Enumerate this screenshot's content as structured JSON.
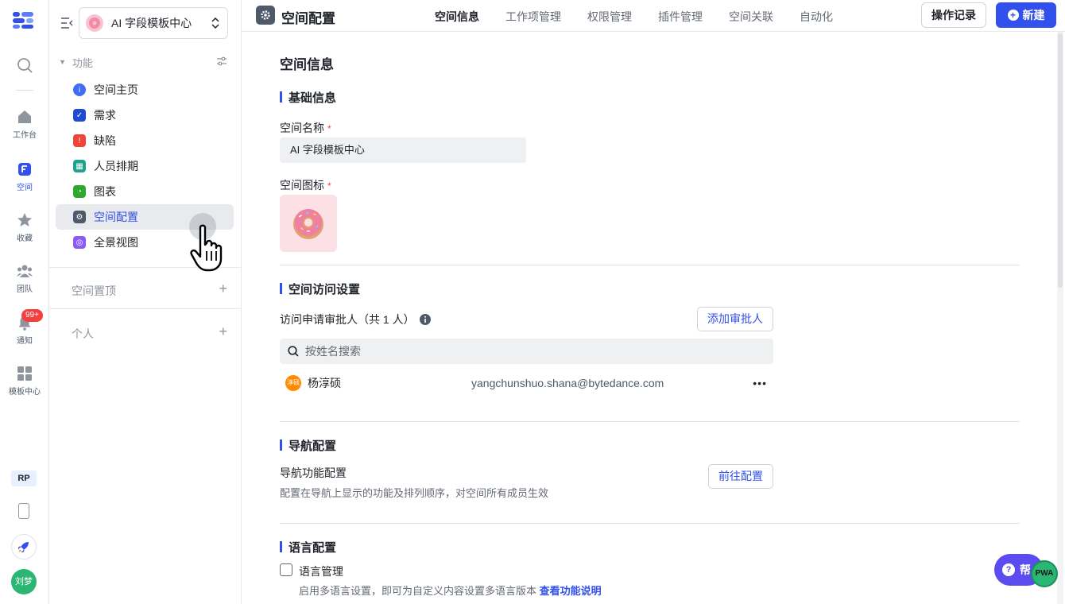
{
  "rail": {
    "items": [
      {
        "label": "工作台",
        "icon": "home-icon"
      },
      {
        "label": "空间",
        "icon": "space-icon",
        "active": true
      },
      {
        "label": "收藏",
        "icon": "star-icon"
      },
      {
        "label": "团队",
        "icon": "team-icon"
      },
      {
        "label": "通知",
        "icon": "bell-icon"
      },
      {
        "label": "模板中心",
        "icon": "template-grid-icon"
      }
    ],
    "notification_badge": "99+",
    "workspace_tag": "RP",
    "user_avatar_text": "刘梦"
  },
  "sidebar": {
    "space_name": "AI 字段模板中心",
    "group_title": "功能",
    "items": [
      {
        "label": "空间主页",
        "color": "#3f6df6",
        "glyph": "i"
      },
      {
        "label": "需求",
        "color": "#1f4bd1",
        "glyph": "✓"
      },
      {
        "label": "缺陷",
        "color": "#f04437",
        "glyph": "!"
      },
      {
        "label": "人员排期",
        "color": "#1fa28c",
        "glyph": "▦"
      },
      {
        "label": "图表",
        "color": "#2fa82f",
        "glyph": "◔"
      },
      {
        "label": "空间配置",
        "color": "#4e5969",
        "glyph": "⚙",
        "active": true
      },
      {
        "label": "全景视图",
        "color": "#8a5cf5",
        "glyph": "◎"
      }
    ],
    "section_pinned": "空间置顶",
    "section_personal": "个人"
  },
  "header": {
    "title": "空间配置",
    "tabs": [
      "空间信息",
      "工作项管理",
      "权限管理",
      "插件管理",
      "空间关联",
      "自动化"
    ],
    "active_tab": "空间信息",
    "log_button": "操作记录",
    "new_button": "新建"
  },
  "main": {
    "page_title": "空间信息",
    "basic": {
      "heading": "基础信息",
      "name_label": "空间名称",
      "name_value": "AI 字段模板中心",
      "icon_label": "空间图标",
      "required_mark": "*"
    },
    "access": {
      "heading": "空间访问设置",
      "approver_label": "访问申请审批人（共 1 人）",
      "add_button": "添加审批人",
      "search_placeholder": "按姓名搜索",
      "members": [
        {
          "avatar": "淳硕",
          "name": "杨淳硕",
          "email": "yangchunshuo.shana@bytedance.com"
        }
      ]
    },
    "nav": {
      "heading": "导航配置",
      "label": "导航功能配置",
      "desc": "配置在导航上显示的功能及排列顺序，对空间所有成员生效",
      "button": "前往配置"
    },
    "lang": {
      "heading": "语言配置",
      "checkbox_label": "语言管理",
      "desc": "启用多语言设置，即可为自定义内容设置多语言版本",
      "link": "查看功能说明"
    }
  },
  "help": {
    "label": "帮",
    "pwa": "PWA"
  },
  "colors": {
    "accent": "#3250eb",
    "danger": "#f53f3f"
  }
}
